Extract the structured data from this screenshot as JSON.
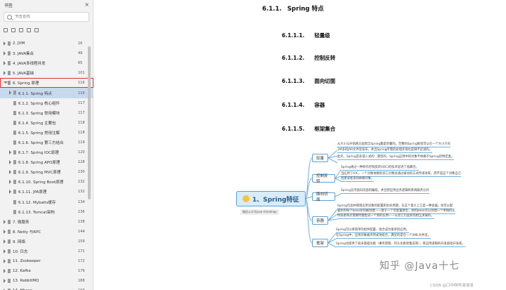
{
  "sidebar": {
    "title": "书签",
    "close_glyph": "×",
    "search_placeholder": "书签查找",
    "items": [
      {
        "label": "2. JVM",
        "page": "16",
        "level": 0,
        "open": false
      },
      {
        "label": "3. JAVA集合",
        "page": "49",
        "level": 0,
        "open": false
      },
      {
        "label": "4. JAVA多线程并发",
        "page": "65",
        "level": 0,
        "open": false
      },
      {
        "label": "5. JAVA基础",
        "page": "101",
        "level": 0,
        "open": false
      },
      {
        "label": "6. Spring 原理",
        "page": "116",
        "level": 0,
        "open": true,
        "highlight": true
      },
      {
        "label": "6.1.1. Spring 特点",
        "page": "116",
        "level": 1,
        "open": false,
        "selected": true
      },
      {
        "label": "6.1.2. Spring 核心组件",
        "page": "117",
        "level": 1
      },
      {
        "label": "6.1.3. Spring 常用模块",
        "page": "117",
        "level": 1
      },
      {
        "label": "6.1.4. Spring 主要包",
        "page": "118",
        "level": 1
      },
      {
        "label": "6.1.5. Spring 常用注解",
        "page": "118",
        "level": 1
      },
      {
        "label": "6.1.6. Spring 第三方结合",
        "page": "119",
        "level": 1
      },
      {
        "label": "6.1.7. Spring IOC原理",
        "page": "120",
        "level": 1,
        "open": false
      },
      {
        "label": "6.1.8. Spring APO原理",
        "page": "128",
        "level": 1,
        "open": false
      },
      {
        "label": "6.1.9. Spring MVC原理",
        "page": "130",
        "level": 1,
        "open": false
      },
      {
        "label": "6.1.10. Spring Boot原理",
        "page": "132",
        "level": 1,
        "open": false
      },
      {
        "label": "6.1.11. JPA原理",
        "page": "132",
        "level": 1,
        "open": false
      },
      {
        "label": "6.1.12. Mybatis缓存",
        "page": "134",
        "level": 1
      },
      {
        "label": "6.1.13. Tomcat架构",
        "page": "136",
        "level": 1
      },
      {
        "label": "7.  微服务",
        "page": "138",
        "level": 0,
        "open": false
      },
      {
        "label": "8. Netty 与RPC",
        "page": "144",
        "level": 0,
        "open": false
      },
      {
        "label": "9. 网络",
        "page": "159",
        "level": 0,
        "open": false
      },
      {
        "label": "10. 日志",
        "page": "171",
        "level": 0,
        "open": false
      },
      {
        "label": "11. Zookeeper",
        "page": "172",
        "level": 0,
        "open": false
      },
      {
        "label": "12. Kafka",
        "page": "179",
        "level": 0,
        "open": false
      },
      {
        "label": "13. RabbitMQ",
        "page": "188",
        "level": 0,
        "open": false
      },
      {
        "label": "14. Hbase",
        "page": "193",
        "level": 0,
        "open": false
      }
    ]
  },
  "doc": {
    "heading_num": "6.1.1.",
    "heading_text": "Spring 特点",
    "subs": [
      {
        "num": "6.1.1.1.",
        "text": "轻量级"
      },
      {
        "num": "6.1.1.2.",
        "text": "控制反转"
      },
      {
        "num": "6.1.1.3.",
        "text": "面向切面"
      },
      {
        "num": "6.1.1.4.",
        "text": "容器"
      },
      {
        "num": "6.1.1.5.",
        "text": "框架集合"
      }
    ]
  },
  "mindmap": {
    "root": "1、Spring特征",
    "root_tag": "微信公众号java-mindmap",
    "branches": [
      {
        "label": "轻量",
        "leaves": [
          "从大小与开销两方面而言Spring都是轻量的。完整的Spring框架可以在一个大小只有",
          "1M多的JAR文件里发布，并且Spring所需的处理开销也是微不足道的。",
          "此外，Spring是非侵入式的：典型的，Spring应用中的对象不依赖于Spring的特定类。"
        ]
      },
      {
        "label": "控制反转",
        "leaves": [
          "Spring通过一种称作控制反转(IOC)的技术促进了低耦合。",
          "当应用了IOC，一个对象依赖的其它对象会通过被动的方式传递进来，而不是这个对象自己",
          "创建或者查找依赖对象。"
        ]
      },
      {
        "label": "面向切面",
        "leaves": [
          "Spring支持面向切面的编程，并且把应用业务逻辑和系统服务分开"
        ]
      },
      {
        "label": "容器",
        "leaves": [
          "Spring包含并管理应用对象的配置和生命周期，在这个意义上它是一种容器，你可以配",
          "置你的每个bean如何被创建——基于一个可配置原型，你的bean可以创建一个单独的实",
          "例或者每次需要时都生成一个新的实例——以及它们是如何相互关联的。"
        ]
      },
      {
        "label": "框架",
        "leaves": [
          "Spring可以将简单的组件配置、组合成为复杂的应用。",
          "在Spring中，应用对象被声明式地组合，典型的是在一个XML文件里。",
          "Spring也提供了很多基础功能（事务管理、持久化框架集成等），将应用逻辑的开发留给开发者。"
        ]
      }
    ]
  },
  "watermark": "知乎 @Java十七",
  "credit": "CSDN @口中咲咩浸浸浸"
}
